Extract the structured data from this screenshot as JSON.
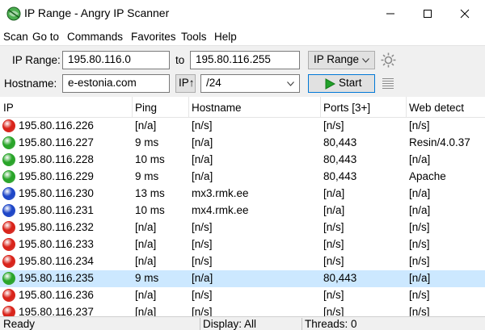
{
  "window": {
    "title": "IP Range - Angry IP Scanner",
    "icon": "angry-ip-scanner-logo"
  },
  "menu": [
    "Scan",
    "Go to",
    "Commands",
    "Favorites",
    "Tools",
    "Help"
  ],
  "toolbar": {
    "ip_range_label": "IP Range:",
    "ip_start": "195.80.116.0",
    "to_label": "to",
    "ip_end": "195.80.116.255",
    "feeder_select": "IP Range",
    "hostname_label": "Hostname:",
    "hostname": "e-estonia.com",
    "ip_button": "IP↑",
    "netmask": "/24",
    "start_button": "Start",
    "icons": [
      "settings-gear-icon",
      "columns-list-icon",
      "play-icon"
    ]
  },
  "table": {
    "columns": [
      "IP",
      "Ping",
      "Hostname",
      "Ports [3+]",
      "Web detect"
    ],
    "rows": [
      {
        "status": "dead",
        "ip": "195.80.116.226",
        "ping": "[n/a]",
        "hostname": "[n/s]",
        "ports": "[n/s]",
        "web": "[n/s]"
      },
      {
        "status": "alive",
        "ip": "195.80.116.227",
        "ping": "9 ms",
        "hostname": "[n/a]",
        "ports": "80,443",
        "web": "Resin/4.0.37"
      },
      {
        "status": "alive",
        "ip": "195.80.116.228",
        "ping": "10 ms",
        "hostname": "[n/a]",
        "ports": "80,443",
        "web": "[n/a]"
      },
      {
        "status": "alive",
        "ip": "195.80.116.229",
        "ping": "9 ms",
        "hostname": "[n/a]",
        "ports": "80,443",
        "web": "Apache"
      },
      {
        "status": "info",
        "ip": "195.80.116.230",
        "ping": "13 ms",
        "hostname": "mx3.rmk.ee",
        "ports": "[n/a]",
        "web": "[n/a]"
      },
      {
        "status": "info",
        "ip": "195.80.116.231",
        "ping": "10 ms",
        "hostname": "mx4.rmk.ee",
        "ports": "[n/a]",
        "web": "[n/a]"
      },
      {
        "status": "dead",
        "ip": "195.80.116.232",
        "ping": "[n/a]",
        "hostname": "[n/s]",
        "ports": "[n/s]",
        "web": "[n/s]"
      },
      {
        "status": "dead",
        "ip": "195.80.116.233",
        "ping": "[n/a]",
        "hostname": "[n/s]",
        "ports": "[n/s]",
        "web": "[n/s]"
      },
      {
        "status": "dead",
        "ip": "195.80.116.234",
        "ping": "[n/a]",
        "hostname": "[n/s]",
        "ports": "[n/s]",
        "web": "[n/s]"
      },
      {
        "status": "alive",
        "ip": "195.80.116.235",
        "ping": "9 ms",
        "hostname": "[n/a]",
        "ports": "80,443",
        "web": "[n/a]",
        "selected": true
      },
      {
        "status": "dead",
        "ip": "195.80.116.236",
        "ping": "[n/a]",
        "hostname": "[n/s]",
        "ports": "[n/s]",
        "web": "[n/s]"
      },
      {
        "status": "dead",
        "ip": "195.80.116.237",
        "ping": "[n/a]",
        "hostname": "[n/s]",
        "ports": "[n/s]",
        "web": "[n/s]"
      }
    ]
  },
  "status_colors": {
    "dead": "#d9241b",
    "alive": "#2aa52a",
    "info": "#1f47c8"
  },
  "statusbar": {
    "state": "Ready",
    "display": "Display: All",
    "threads": "Threads: 0"
  }
}
